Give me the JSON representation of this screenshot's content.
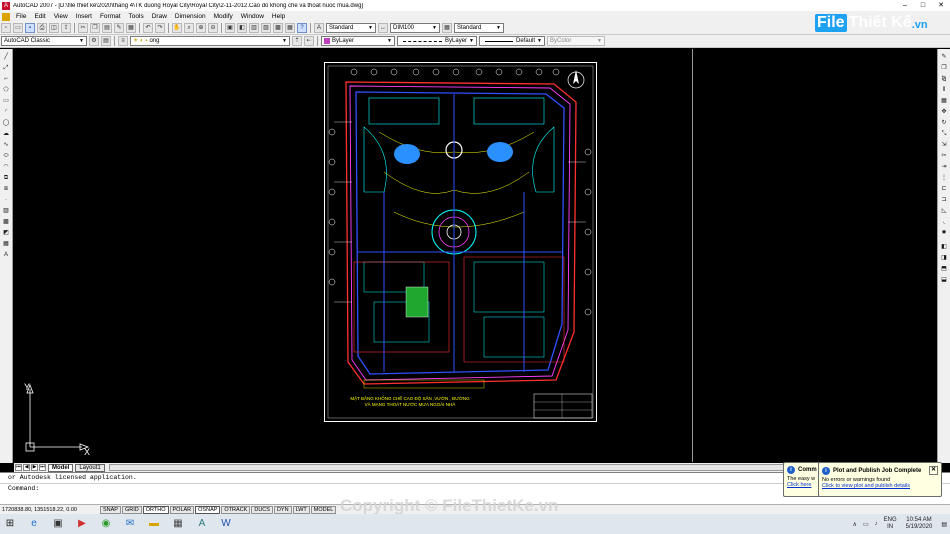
{
  "window": {
    "title": "AutoCAD 2007 - [D:\\file thiết kế\\2020\\thang 4\\TK duong Royal City\\Royal City\\2-11-2012.Cao do khong che va thoat nuoc mua.dwg]",
    "min": "–",
    "max": "□",
    "close": "✕"
  },
  "menu": [
    "File",
    "Edit",
    "View",
    "Insert",
    "Format",
    "Tools",
    "Draw",
    "Dimension",
    "Modify",
    "Window",
    "Help"
  ],
  "toolbar1": {
    "text_style": "Standard",
    "dim_style": "DIM100",
    "table_style": "Standard"
  },
  "toolbar2": {
    "workspace": "AutoCAD Classic",
    "layer": "ong",
    "color": "ByLayer",
    "linetype": "ByLayer",
    "lineweight": "Default",
    "plotstyle": "ByColor"
  },
  "tabs": [
    "Model",
    "Layout1"
  ],
  "command": {
    "line1": "or Autodesk licensed application.",
    "line2": "Command:"
  },
  "status": {
    "coords": "1720838.80, 1351518.22, 0.00",
    "buttons": [
      "SNAP",
      "GRID",
      "ORTHO",
      "POLAR",
      "OSNAP",
      "OTRACK",
      "DUCS",
      "DYN",
      "LWT",
      "MODEL"
    ]
  },
  "ucs": {
    "x": "X",
    "y": "Y"
  },
  "balloon1": {
    "title": "Comm",
    "text": "The easy w",
    "link": "Click here"
  },
  "balloon2": {
    "title": "Plot and Publish Job Complete",
    "text": "No errors or warnings found",
    "link": "Click to view plot and publish details",
    "close": "✕"
  },
  "drawing_title": {
    "line1": "MẶT BẰNG KHỐNG CHẾ CAO ĐỘ SÂN ,VƯỜN , ĐƯỜNG",
    "line2": "VÀ MẠNG THOÁT NƯỚC MƯA NGOÀI NHÀ"
  },
  "logo": {
    "brand": "File",
    "name": "Thiết Kế",
    "tld": ".vn"
  },
  "watermark": "Copyright © FileThietKe.vn",
  "taskbar": {
    "lang1": "ENG",
    "lang2": "IN",
    "time": "10:54 AM",
    "date": "5/19/2020"
  }
}
